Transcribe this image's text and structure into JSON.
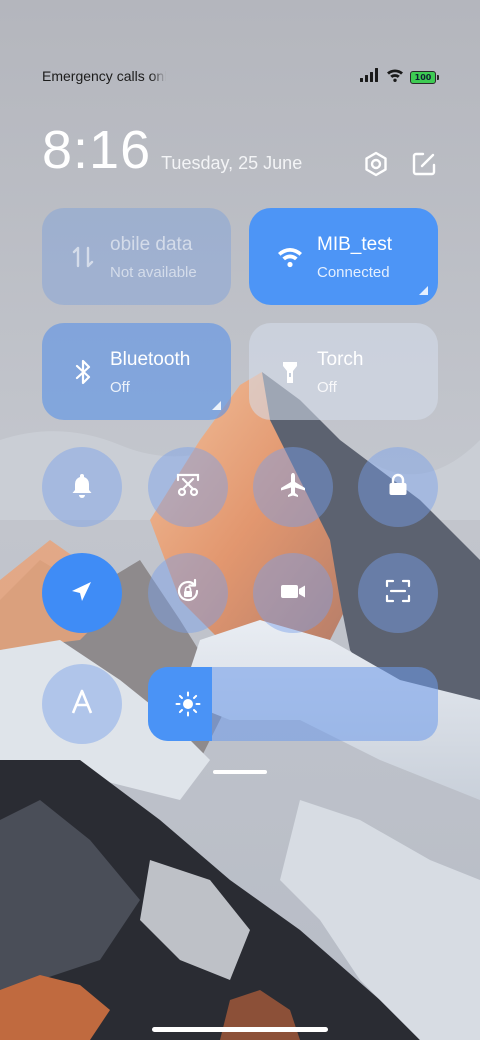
{
  "status_bar": {
    "carrier_text": "Emergency calls only",
    "battery_level": "100",
    "signal_icon": "signal-icon",
    "wifi_icon": "wifi-icon"
  },
  "header": {
    "time": "8:16",
    "date": "Tuesday, 25 June",
    "settings_icon": "settings-icon",
    "edit_icon": "edit-icon"
  },
  "tiles": {
    "mobile_data": {
      "label": "Mobile data",
      "visible_label": "obile data",
      "status": "Not available",
      "state": "disabled",
      "icon": "mobile-data-icon"
    },
    "wifi": {
      "label": "MIB_test",
      "status": "Connected",
      "state": "on",
      "icon": "wifi-icon"
    },
    "bluetooth": {
      "label": "Bluetooth",
      "status": "Off",
      "state": "off",
      "icon": "bluetooth-icon"
    },
    "torch": {
      "label": "Torch",
      "status": "Off",
      "state": "off",
      "icon": "torch-icon"
    }
  },
  "toggles": [
    {
      "name": "silent",
      "icon": "bell-icon",
      "state": "off"
    },
    {
      "name": "screenshot",
      "icon": "scissors-icon",
      "state": "off"
    },
    {
      "name": "airplane-mode",
      "icon": "airplane-icon",
      "state": "off"
    },
    {
      "name": "lock-screen",
      "icon": "lock-icon",
      "state": "off"
    },
    {
      "name": "location",
      "icon": "location-arrow-icon",
      "state": "on"
    },
    {
      "name": "rotation-lock",
      "icon": "rotation-lock-icon",
      "state": "off"
    },
    {
      "name": "screen-recorder",
      "icon": "video-camera-icon",
      "state": "off"
    },
    {
      "name": "scanner",
      "icon": "scan-icon",
      "state": "off"
    },
    {
      "name": "font-size",
      "icon": "font-a-icon",
      "state": "off"
    }
  ],
  "brightness": {
    "icon": "sun-icon",
    "level": 0.22
  },
  "colors": {
    "accent": "#4d95f6",
    "tile_off": "#d6deec",
    "text_light": "#ffffff"
  }
}
